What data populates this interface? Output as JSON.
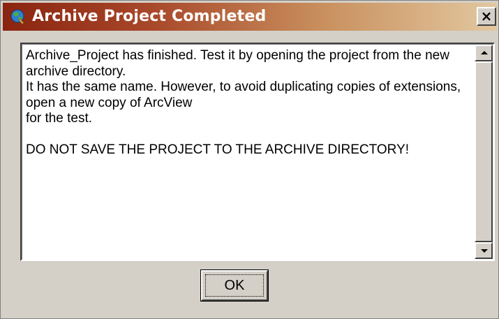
{
  "window": {
    "title": "Archive Project Completed",
    "icon": "arcview-globe-icon",
    "close_label": "×",
    "accent_color": "#8a2410"
  },
  "message": {
    "lines": [
      "Archive_Project has finished.  Test it by opening the project from the new archive directory.",
      "It has the same name.  However, to avoid duplicating copies of extensions, open a new copy of ArcView",
      "for the test.",
      "",
      "DO NOT SAVE THE PROJECT TO THE ARCHIVE DIRECTORY!"
    ]
  },
  "scrollbar": {
    "up_icon": "scroll-up-arrow-icon",
    "down_icon": "scroll-down-arrow-icon"
  },
  "buttons": {
    "ok_label": "OK"
  }
}
